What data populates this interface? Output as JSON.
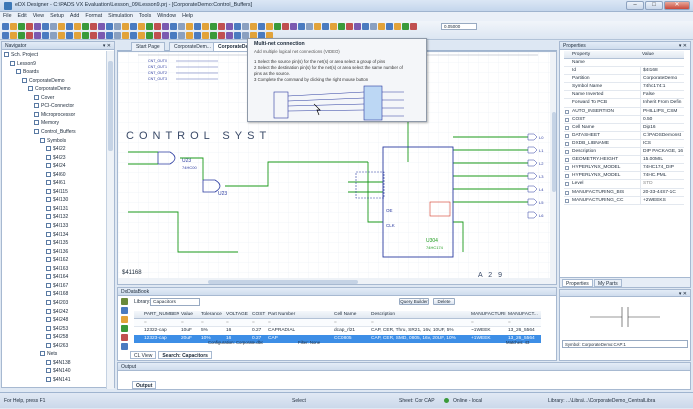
{
  "window": {
    "title": "eDX Designer - C:\\PADS VX Evaluation\\Lesson_09\\Lesson9.prj - [CorporateDemo:Control_Buffers]"
  },
  "menu": [
    "File",
    "Edit",
    "View",
    "Setup",
    "Add",
    "Format",
    "Simulation",
    "Tools",
    "Window",
    "Help"
  ],
  "toolbar": {
    "zoom_value": "0.05000"
  },
  "navigator": {
    "title": "Navigator",
    "tree": [
      {
        "label": "Sch. Project",
        "indent": 0
      },
      {
        "label": "Lesson9",
        "indent": 1
      },
      {
        "label": "Boards",
        "indent": 2
      },
      {
        "label": "CorporateDemo",
        "indent": 3
      },
      {
        "label": "CorporateDemo",
        "indent": 4
      },
      {
        "label": "Cover",
        "indent": 5
      },
      {
        "label": "PCI-Connector",
        "indent": 5
      },
      {
        "label": "Microprocessor",
        "indent": 5
      },
      {
        "label": "Memory",
        "indent": 5
      },
      {
        "label": "Control_Buffers",
        "indent": 5
      },
      {
        "label": "Symbols",
        "indent": 6
      },
      {
        "label": "$4I22",
        "indent": 7
      },
      {
        "label": "$4I23",
        "indent": 7
      },
      {
        "label": "$4I24",
        "indent": 7
      },
      {
        "label": "$4I60",
        "indent": 7
      },
      {
        "label": "$4I61",
        "indent": 7
      },
      {
        "label": "$4I115",
        "indent": 7
      },
      {
        "label": "$4I130",
        "indent": 7
      },
      {
        "label": "$4I131",
        "indent": 7
      },
      {
        "label": "$4I132",
        "indent": 7
      },
      {
        "label": "$4I133",
        "indent": 7
      },
      {
        "label": "$4I134",
        "indent": 7
      },
      {
        "label": "$4I135",
        "indent": 7
      },
      {
        "label": "$4I136",
        "indent": 7
      },
      {
        "label": "$4I162",
        "indent": 7
      },
      {
        "label": "$4I163",
        "indent": 7
      },
      {
        "label": "$4I164",
        "indent": 7
      },
      {
        "label": "$4I167",
        "indent": 7
      },
      {
        "label": "$4I168",
        "indent": 7
      },
      {
        "label": "$4I203",
        "indent": 7
      },
      {
        "label": "$4I242",
        "indent": 7
      },
      {
        "label": "$4I248",
        "indent": 7
      },
      {
        "label": "$4I253",
        "indent": 7
      },
      {
        "label": "$4I258",
        "indent": 7
      },
      {
        "label": "$4I263",
        "indent": 7
      },
      {
        "label": "Nets",
        "indent": 6
      },
      {
        "label": "$4N138",
        "indent": 7
      },
      {
        "label": "$4N140",
        "indent": 7
      },
      {
        "label": "$4N141",
        "indent": 7
      }
    ]
  },
  "doc_tabs": [
    "Start Page",
    "CorporateDem...",
    "CorporateDem..."
  ],
  "tooltip": {
    "title": "Multi-net connection",
    "subtitle": "Add multiple logical net connections (VIDEO)",
    "steps": [
      "1 Select the source pin(s) for the net(s) or area select a group of pins",
      "2 Select the destination pin(s) for the net(s) or area select the same number of",
      "pins as the source.",
      "3 Complete the command by clicking the right mouse button"
    ]
  },
  "canvas": {
    "sheet_title": "CONTROL SYST",
    "ref_u23_1": "U23",
    "part_u23_1": "74HC00",
    "ref_u23_2": "U23",
    "ref_u304": "U304",
    "part_u304": "74HC174",
    "pin_oe": "OE",
    "pin_clk": "CLK",
    "sheet_ref": "$41168",
    "zone": "A 2 9",
    "net_labels": [
      "CNT_OUT0",
      "CNT_OUT1",
      "CNT_OUT2",
      "CNT_OUT3"
    ],
    "right_labels": [
      "L0",
      "L1",
      "L2",
      "L3",
      "L4",
      "L5",
      "L6"
    ]
  },
  "properties": {
    "title": "Properties",
    "col_property": "Property",
    "col_value": "Value",
    "rows": [
      {
        "k": "Name",
        "v": "",
        "cb": false
      },
      {
        "k": "Id",
        "v": "$4I168",
        "cb": false
      },
      {
        "k": "Partition",
        "v": "CorporateDemo",
        "cb": false
      },
      {
        "k": "Symbol Name",
        "v": "74hc174:1",
        "cb": false
      },
      {
        "k": "Name Inverted",
        "v": "False",
        "cb": false
      },
      {
        "k": "Forward To PCB",
        "v": "Inherit From Defin",
        "cb": false
      },
      {
        "k": "AUTO_INSERTION",
        "v": "PHILLIPS_CSM",
        "cb": true
      },
      {
        "k": "COST",
        "v": "0.50",
        "cb": true
      },
      {
        "k": "Cell Name",
        "v": "Dip16",
        "cb": true
      },
      {
        "k": "DATASHEET",
        "v": "C:\\PADSDemonst",
        "cb": true
      },
      {
        "k": "DXDB_LIBNAME",
        "v": "ICS",
        "cb": true
      },
      {
        "k": "Description",
        "v": "DIP PACKAGE, 16",
        "cb": true
      },
      {
        "k": "GEOMETRY.HEIGHT",
        "v": "15.00MIL",
        "cb": true
      },
      {
        "k": "HYPERLYNX_MODEL",
        "v": "74HC174_DIP",
        "cb": true
      },
      {
        "k": "HYPERLYNX_MODEL",
        "v": "74HC.PML",
        "cb": true
      },
      {
        "k": "Level",
        "v": "STD",
        "cb": true
      },
      {
        "k": "MANUFACTURING_BIS",
        "v": "20-33-44S7-1C",
        "cb": true
      },
      {
        "k": "MANUFACTURING_CC",
        "v": "+2WEEKS",
        "cb": true
      }
    ],
    "tabs": [
      "Properties",
      "My Parts"
    ]
  },
  "databook": {
    "title": "DxDataBook",
    "library_label": "Library:",
    "library_value": "Capacitors",
    "query_button": "Query Builder",
    "delete_button": "Delete",
    "columns": [
      "PART_NUMBER",
      "Value",
      "Tolerance",
      "VOLTAGE",
      "COST",
      "Part Number",
      "Cell Name",
      "Description",
      "MANUFACTURING",
      "MANUFACT..."
    ],
    "rows": [
      [
        "12322-cap",
        "10uF",
        "5%",
        "16",
        "0.27",
        "CAPRADIAL",
        "dcap_rl21",
        "CAP, CER, Thru, SR21, 16v, 10UF, 5%",
        "~1WEEK",
        "13_26_5564"
      ],
      [
        "12323-cap",
        "20uF",
        "10%",
        "16",
        "0.27",
        "CAP",
        "CC0805",
        "CAP, CER, SMD, 0805, 16v, 20UF, 10%",
        "+1WEEK",
        "13_26_5564"
      ]
    ],
    "config_label": "Configuration: Corporate.dbc",
    "filter_label": "Filter: None",
    "matches": "Matches: 43",
    "bottom_tabs": [
      "CL View",
      "Search: Capacitors"
    ]
  },
  "preview": {
    "symbol_label": "Symbol: CorporateDemo:CAP:1"
  },
  "output": {
    "title": "Output",
    "tab": "Output"
  },
  "status": {
    "left": "For Help, press F1",
    "mode": "Select",
    "sheet": "Sheet: Cor CAP",
    "online": "Online - local",
    "library": "Library: ...\\Libra\\...\\CorporateDemo_CentralLibra"
  },
  "colors": {
    "accent": "#3d8ee6",
    "wire": "#1a9a1a",
    "component": "#2a3aa0",
    "grid": "#d9dfe8"
  }
}
